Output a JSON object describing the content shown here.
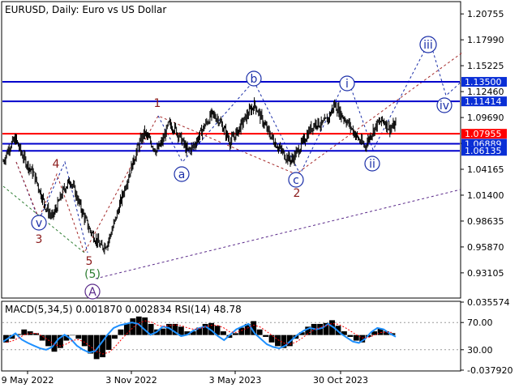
{
  "header": {
    "symbol": "EURUSD",
    "timeframe": "Daily",
    "description": "Euro vs US Dollar"
  },
  "chart_data": [
    {
      "type": "candlestick",
      "symbol": "EURUSD",
      "timeframe": "Daily",
      "ylim": [
        0.905,
        1.2198
      ],
      "y_ticks": [
        "1.20755",
        "1.17990",
        "1.15225",
        "1.12460",
        "1.09690",
        "1.06925",
        "1.04165",
        "1.01400",
        "0.98635",
        "0.95870",
        "0.93105"
      ],
      "x_ticks": [
        "9 May 2022",
        "3 Nov 2022",
        "3 May 2023",
        "30 Oct 2023"
      ],
      "price_path": [
        1.05,
        1.066,
        1.074,
        1.058,
        1.046,
        1.036,
        1.018,
        1.0,
        0.99,
        1.006,
        1.022,
        1.03,
        1.012,
        0.994,
        0.978,
        0.968,
        0.958,
        0.963,
        0.982,
        1.004,
        1.026,
        1.046,
        1.066,
        1.081,
        1.071,
        1.061,
        1.072,
        1.09,
        1.085,
        1.074,
        1.061,
        1.066,
        1.078,
        1.09,
        1.1,
        1.096,
        1.084,
        1.071,
        1.08,
        1.091,
        1.102,
        1.111,
        1.097,
        1.084,
        1.073,
        1.064,
        1.056,
        1.051,
        1.061,
        1.072,
        1.084,
        1.092,
        1.089,
        1.096,
        1.111,
        1.101,
        1.093,
        1.083,
        1.073,
        1.066,
        1.08,
        1.09,
        1.094,
        1.085,
        1.089
      ],
      "horizontal_levels": [
        {
          "label": "1.13500",
          "color": "#0000cc",
          "bg": "#0a2fd6",
          "fg": "#ffffff"
        },
        {
          "label": "1.11414",
          "color": "#0000cc",
          "bg": "#0a2fd6",
          "fg": "#ffffff"
        },
        {
          "label": "1.07955",
          "color": "#ff0000",
          "bg": "#ff0000",
          "fg": "#ffffff"
        },
        {
          "label": "1.06889",
          "color": "#0000cc",
          "bg": "#0a2fd6",
          "fg": "#ffffff"
        },
        {
          "label": "1.06135",
          "color": "#0000cc",
          "bg": "#0a2fd6",
          "fg": "#ffffff"
        }
      ],
      "wave_labels": [
        {
          "text": "v",
          "color": "#1a2ea8",
          "circled": true
        },
        {
          "text": "3",
          "color": "#8b1a1a",
          "circled": false
        },
        {
          "text": "4",
          "color": "#8b1a1a",
          "circled": false
        },
        {
          "text": "5",
          "color": "#8b1a1a",
          "circled": false
        },
        {
          "text": "(5)",
          "color": "#2e7d32",
          "circled": false
        },
        {
          "text": "A",
          "color": "#5a2a8a",
          "circled": true
        },
        {
          "text": "1",
          "color": "#8b1a1a",
          "circled": false
        },
        {
          "text": "a",
          "color": "#1a2ea8",
          "circled": true
        },
        {
          "text": "b",
          "color": "#1a2ea8",
          "circled": true
        },
        {
          "text": "c",
          "color": "#1a2ea8",
          "circled": true
        },
        {
          "text": "2",
          "color": "#8b1a1a",
          "circled": false
        },
        {
          "text": "i",
          "color": "#1a2ea8",
          "circled": true
        },
        {
          "text": "ii",
          "color": "#1a2ea8",
          "circled": true
        },
        {
          "text": "iii",
          "color": "#1a2ea8",
          "circled": true
        },
        {
          "text": "iv",
          "color": "#1a2ea8",
          "circled": true
        }
      ]
    },
    {
      "type": "histogram",
      "indicator": "MACD(5,34,5) 0.001870 0.002834 RSI(14) 48.78",
      "y_ticks": [
        "0.035574",
        "70.00",
        "30.00",
        "-0.037920"
      ],
      "rsi_levels": [
        70,
        30
      ],
      "macd_values": [
        -0.008,
        -0.004,
        0.001,
        0.006,
        0.004,
        0.002,
        -0.006,
        -0.012,
        -0.018,
        -0.014,
        -0.006,
        0.0,
        -0.004,
        -0.012,
        -0.02,
        -0.026,
        -0.024,
        -0.016,
        -0.004,
        0.006,
        0.012,
        0.018,
        0.02,
        0.019,
        0.012,
        0.006,
        0.007,
        0.012,
        0.012,
        0.009,
        0.004,
        0.004,
        0.008,
        0.012,
        0.013,
        0.01,
        0.004,
        -0.003,
        0.002,
        0.008,
        0.012,
        0.015,
        0.006,
        -0.002,
        -0.008,
        -0.012,
        -0.014,
        -0.012,
        -0.004,
        0.003,
        0.009,
        0.012,
        0.012,
        0.013,
        0.016,
        0.01,
        0.004,
        -0.002,
        -0.006,
        -0.008,
        -0.002,
        0.004,
        0.007,
        0.004,
        0.002
      ],
      "rsi_values": [
        42,
        48,
        54,
        45,
        40,
        36,
        32,
        30,
        34,
        46,
        52,
        46,
        36,
        30,
        26,
        28,
        40,
        52,
        62,
        66,
        68,
        70,
        68,
        60,
        52,
        56,
        64,
        62,
        56,
        50,
        52,
        58,
        62,
        64,
        58,
        50,
        44,
        52,
        60,
        64,
        68,
        54,
        46,
        38,
        34,
        32,
        36,
        44,
        52,
        58,
        62,
        60,
        62,
        68,
        62,
        54,
        48,
        42,
        40,
        46,
        56,
        62,
        60,
        54,
        49
      ]
    }
  ]
}
